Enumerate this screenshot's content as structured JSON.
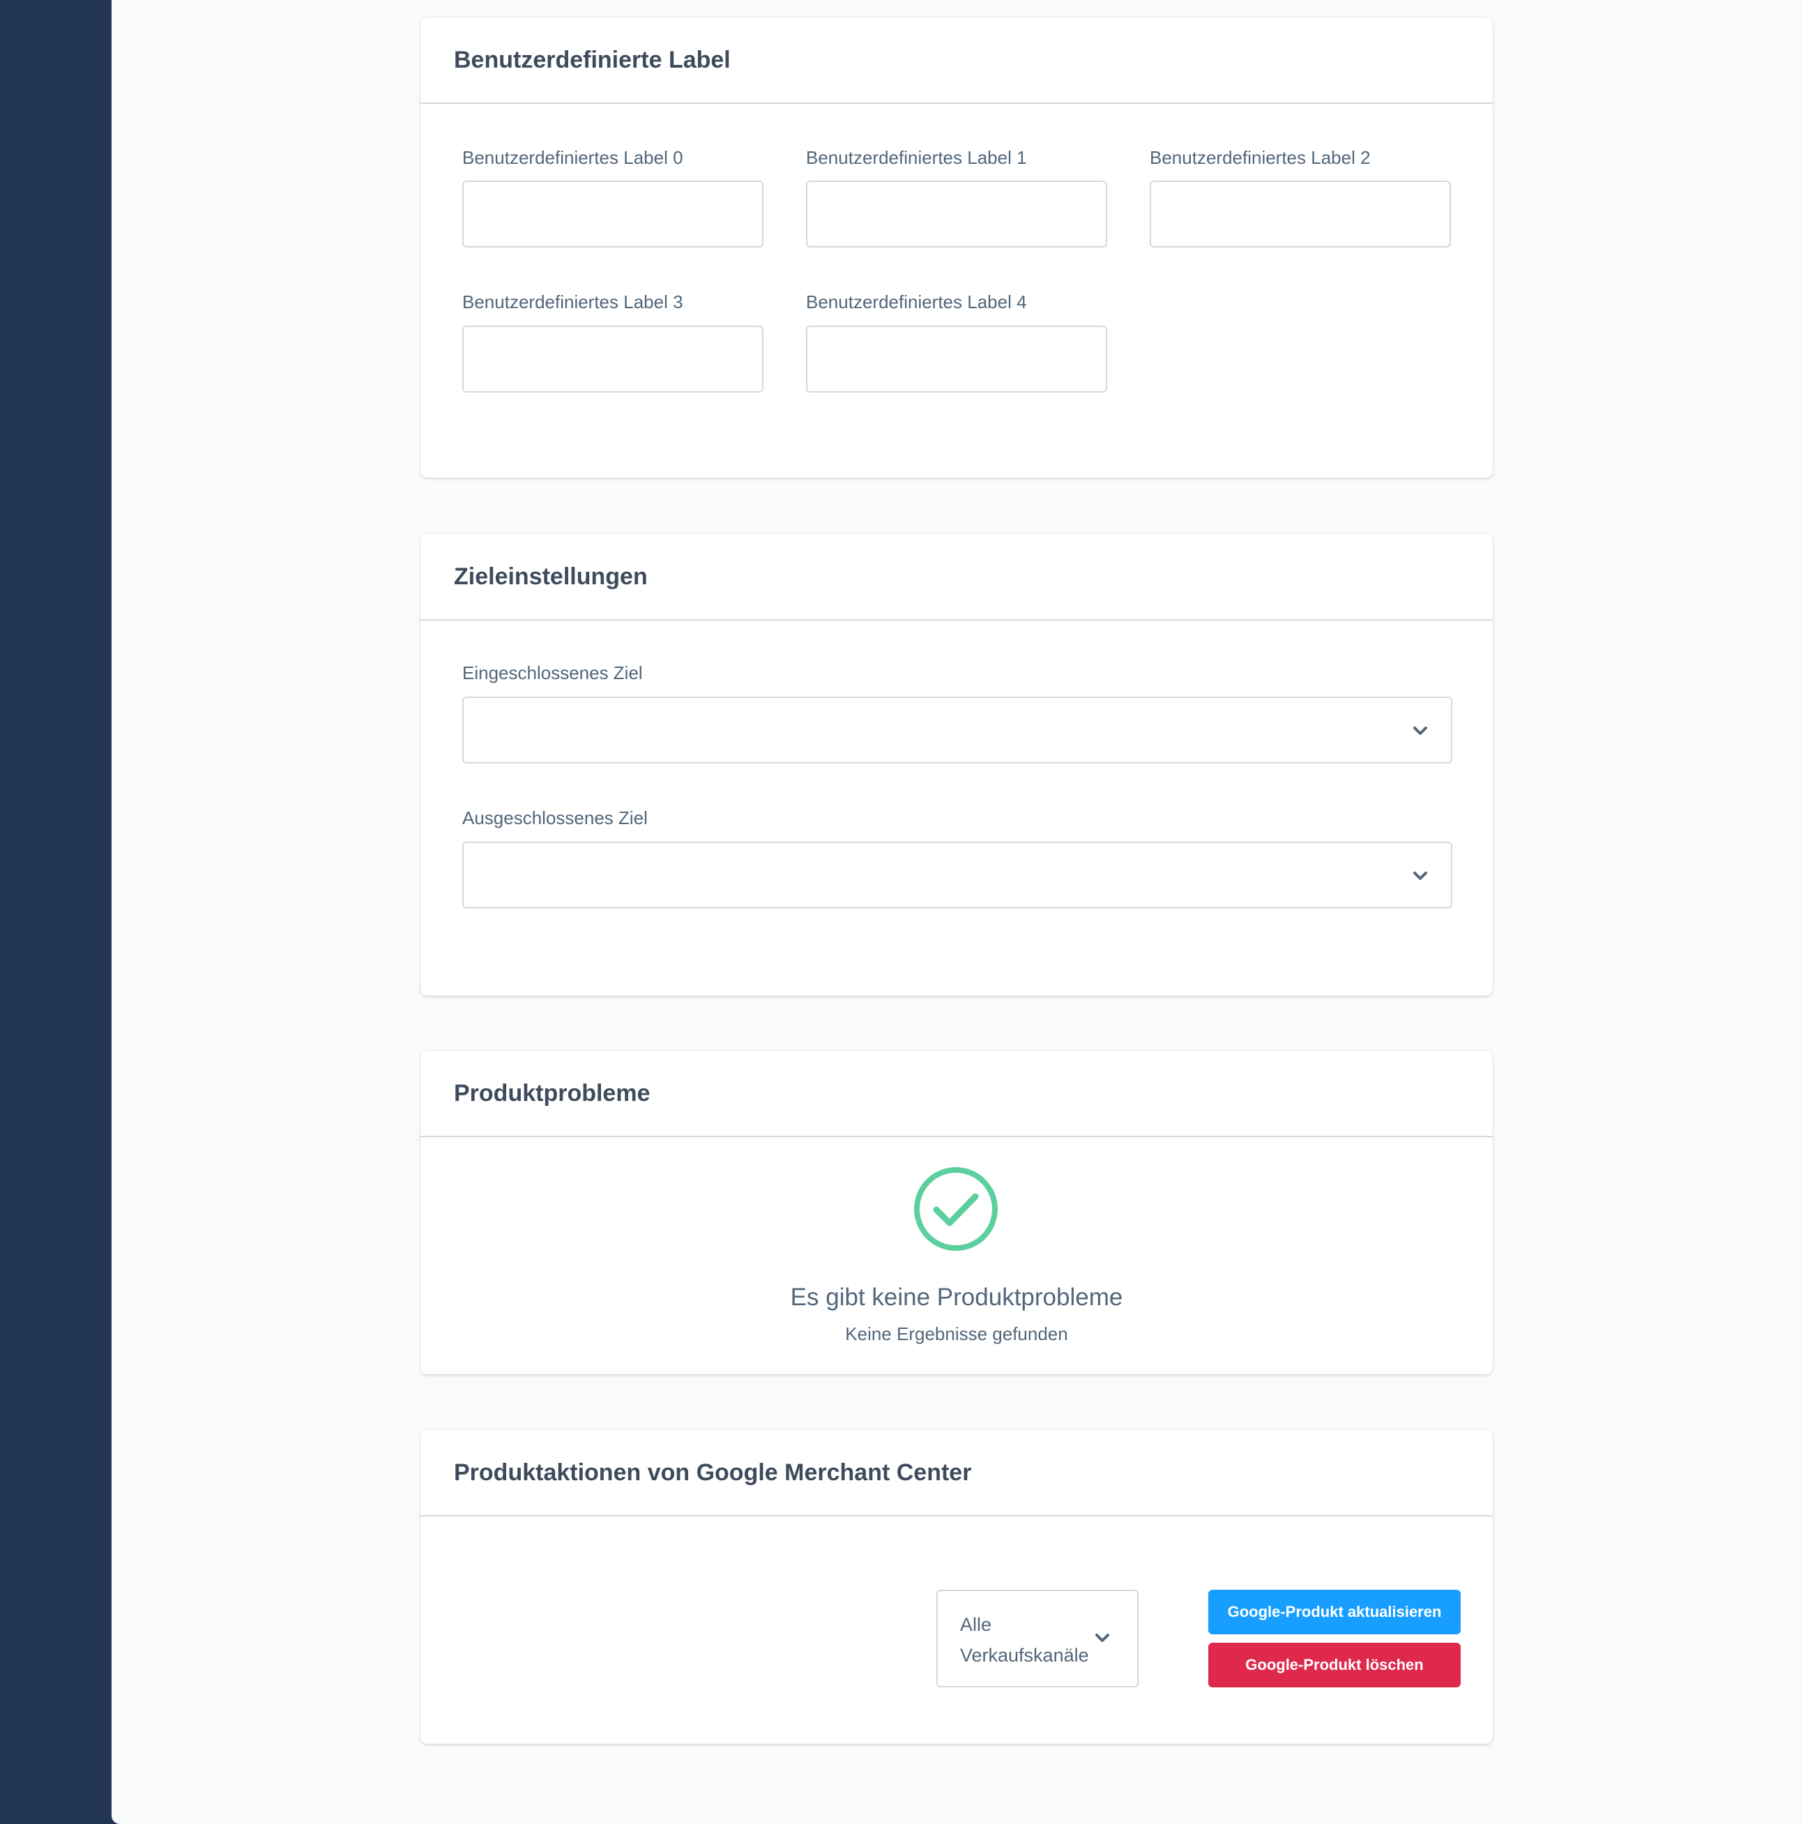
{
  "custom_labels": {
    "title": "Benutzerdefinierte Label",
    "fields": [
      {
        "label": "Benutzerdefiniertes Label 0",
        "value": ""
      },
      {
        "label": "Benutzerdefiniertes Label 1",
        "value": ""
      },
      {
        "label": "Benutzerdefiniertes Label 2",
        "value": ""
      },
      {
        "label": "Benutzerdefiniertes Label 3",
        "value": ""
      },
      {
        "label": "Benutzerdefiniertes Label 4",
        "value": ""
      }
    ]
  },
  "destination_settings": {
    "title": "Zieleinstellungen",
    "included_label": "Eingeschlossenes Ziel",
    "included_value": "",
    "excluded_label": "Ausgeschlossenes Ziel",
    "excluded_value": ""
  },
  "product_issues": {
    "title": "Produktprobleme",
    "empty_icon": "check-circle-icon",
    "empty_title": "Es gibt keine Produktprobleme",
    "empty_subtitle": "Keine Ergebnisse gefunden"
  },
  "merchant_actions": {
    "title": "Produktaktionen von Google Merchant Center",
    "channel_select": {
      "selected": "Alle Verkaufskanäle"
    },
    "update_button": "Google-Produkt aktualisieren",
    "delete_button": "Google-Produkt löschen"
  },
  "colors": {
    "sidebar": "#233554",
    "background": "#f9fafb",
    "primary": "#189eff",
    "danger": "#de294c",
    "success": "#5ccf9e"
  }
}
